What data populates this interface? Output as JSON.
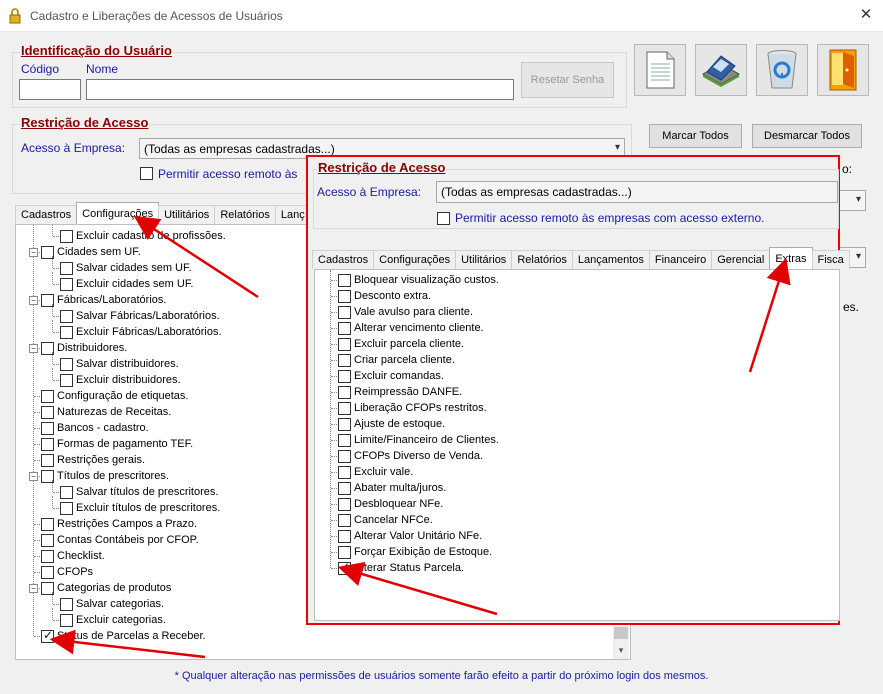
{
  "window": {
    "title": "Cadastro e Liberações de Acessos de Usuários",
    "close_glyph": "✕"
  },
  "identificacao": {
    "section_title": "Identificação do Usuário",
    "codigo_label": "Código",
    "nome_label": "Nome",
    "codigo_value": "",
    "nome_value": "",
    "reset_button": "Resetar Senha"
  },
  "toolbar_icons": [
    "new-document-icon",
    "save-disk-icon",
    "recycle-bin-icon",
    "exit-door-icon"
  ],
  "restricao": {
    "section_title": "Restrição de Acesso",
    "acesso_label": "Acesso à Empresa:",
    "acesso_value": "(Todas as empresas cadastradas...)",
    "remoto_label": "Permitir acesso remoto às"
  },
  "buttons": {
    "marcar_todos": "Marcar Todos",
    "desmarcar_todos": "Desmarcar Todos"
  },
  "right_partial": {
    "label_fragment": "o:",
    "text_fragment": "es."
  },
  "main_tabs": [
    "Cadastros",
    "Configurações",
    "Utilitários",
    "Relatórios",
    "Lanç"
  ],
  "main_tree": [
    {
      "label": "Excluir cadastro de profissões.",
      "level": 2,
      "checked": false
    },
    {
      "label": "Cidades sem UF.",
      "level": 1,
      "checked": false,
      "expander": true
    },
    {
      "label": "Salvar cidades sem UF.",
      "level": 2,
      "checked": false
    },
    {
      "label": "Excluir cidades sem UF.",
      "level": 2,
      "checked": false
    },
    {
      "label": "Fábricas/Laboratórios.",
      "level": 1,
      "checked": false,
      "expander": true
    },
    {
      "label": "Salvar Fábricas/Laboratórios.",
      "level": 2,
      "checked": false
    },
    {
      "label": "Excluir Fábricas/Laboratórios.",
      "level": 2,
      "checked": false
    },
    {
      "label": "Distribuidores.",
      "level": 1,
      "checked": false,
      "expander": true
    },
    {
      "label": "Salvar distribuidores.",
      "level": 2,
      "checked": false
    },
    {
      "label": "Excluir distribuidores.",
      "level": 2,
      "checked": false
    },
    {
      "label": "Configuração de etiquetas.",
      "level": 1,
      "checked": false
    },
    {
      "label": "Naturezas de Receitas.",
      "level": 1,
      "checked": false
    },
    {
      "label": "Bancos - cadastro.",
      "level": 1,
      "checked": false
    },
    {
      "label": "Formas de pagamento TEF.",
      "level": 1,
      "checked": false
    },
    {
      "label": "Restrições gerais.",
      "level": 1,
      "checked": false
    },
    {
      "label": "Títulos de prescritores.",
      "level": 1,
      "checked": false,
      "expander": true
    },
    {
      "label": "Salvar títulos de prescritores.",
      "level": 2,
      "checked": false
    },
    {
      "label": "Excluir títulos de prescritores.",
      "level": 2,
      "checked": false
    },
    {
      "label": "Restrições Campos a Prazo.",
      "level": 1,
      "checked": false
    },
    {
      "label": "Contas Contábeis por CFOP.",
      "level": 1,
      "checked": false
    },
    {
      "label": "Checklist.",
      "level": 1,
      "checked": false
    },
    {
      "label": "CFOPs",
      "level": 1,
      "checked": false
    },
    {
      "label": "Categorias de produtos",
      "level": 1,
      "checked": false,
      "expander": true
    },
    {
      "label": "Salvar categorias.",
      "level": 2,
      "checked": false
    },
    {
      "label": "Excluir categorias.",
      "level": 2,
      "checked": false
    },
    {
      "label": "Status de Parcelas a Receber.",
      "level": 1,
      "checked": true
    }
  ],
  "overlay": {
    "section_title": "Restrição de Acesso",
    "acesso_label": "Acesso à Empresa:",
    "acesso_value": "(Todas as empresas cadastradas...)",
    "remoto_label": "Permitir acesso remoto às empresas com acesso externo.",
    "tabs": [
      "Cadastros",
      "Configurações",
      "Utilitários",
      "Relatórios",
      "Lançamentos",
      "Financeiro",
      "Gerencial",
      "Extras",
      "Fisca"
    ],
    "active_tab": "Extras",
    "tree": [
      {
        "label": "Bloquear visualização custos.",
        "checked": false
      },
      {
        "label": "Desconto extra.",
        "checked": false
      },
      {
        "label": "Vale avulso para cliente.",
        "checked": false
      },
      {
        "label": "Alterar vencimento cliente.",
        "checked": false
      },
      {
        "label": "Excluir parcela cliente.",
        "checked": false
      },
      {
        "label": "Criar parcela cliente.",
        "checked": false
      },
      {
        "label": "Excluir comandas.",
        "checked": false
      },
      {
        "label": "Reimpressão DANFE.",
        "checked": false
      },
      {
        "label": "Liberação CFOPs restritos.",
        "checked": false
      },
      {
        "label": "Ajuste de estoque.",
        "checked": false
      },
      {
        "label": "Limite/Financeiro de Clientes.",
        "checked": false
      },
      {
        "label": "CFOPs Diverso de Venda.",
        "checked": false
      },
      {
        "label": "Excluir vale.",
        "checked": false
      },
      {
        "label": "Abater multa/juros.",
        "checked": false
      },
      {
        "label": "Desbloquear NFe.",
        "checked": false
      },
      {
        "label": "Cancelar NFCe.",
        "checked": false
      },
      {
        "label": "Alterar Valor Unitário NFe.",
        "checked": false
      },
      {
        "label": "Forçar Exibição de Estoque.",
        "checked": false
      },
      {
        "label": "Alterar Status Parcela.",
        "checked": true
      }
    ]
  },
  "footer_note": "* Qualquer alteração nas permissões de usuários somente farão efeito a partir do próximo login dos mesmos.",
  "colors": {
    "section_title": "#8b0000",
    "label_blue": "#1a1aa6",
    "annotation_red": "#e00000"
  }
}
